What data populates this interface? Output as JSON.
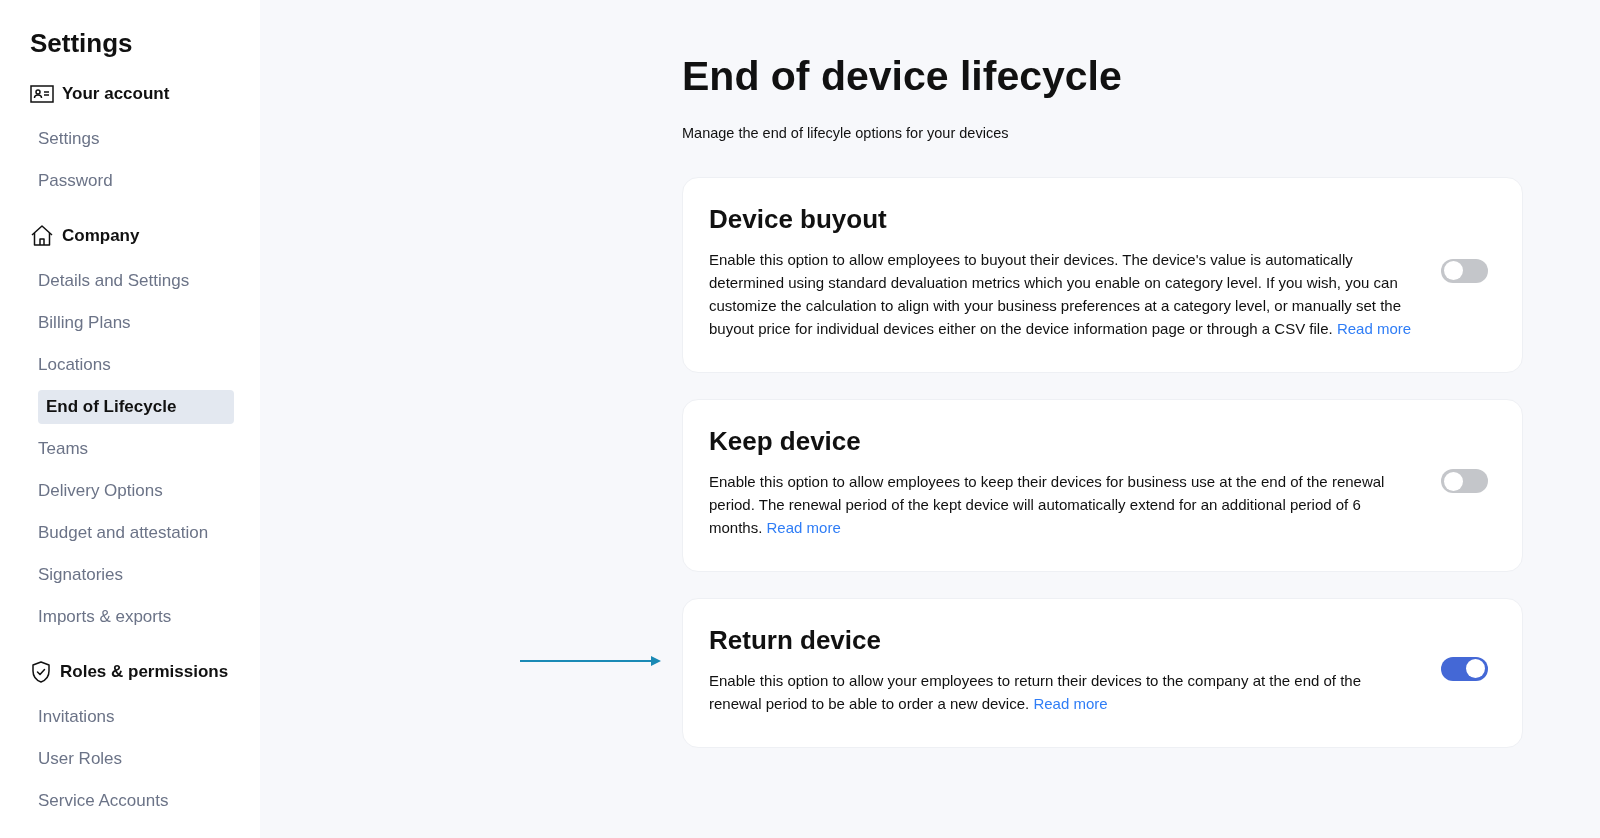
{
  "sidebar": {
    "title": "Settings",
    "groups": [
      {
        "label": "Your account",
        "items": [
          {
            "label": "Settings",
            "selected": false
          },
          {
            "label": "Password",
            "selected": false
          }
        ]
      },
      {
        "label": "Company",
        "items": [
          {
            "label": "Details and Settings",
            "selected": false
          },
          {
            "label": "Billing Plans",
            "selected": false
          },
          {
            "label": "Locations",
            "selected": false
          },
          {
            "label": "End of Lifecycle",
            "selected": true
          },
          {
            "label": "Teams",
            "selected": false
          },
          {
            "label": "Delivery Options",
            "selected": false
          },
          {
            "label": "Budget and attestation",
            "selected": false
          },
          {
            "label": "Signatories",
            "selected": false
          },
          {
            "label": "Imports & exports",
            "selected": false
          }
        ]
      },
      {
        "label": "Roles & permissions",
        "items": [
          {
            "label": "Invitations",
            "selected": false
          },
          {
            "label": "User Roles",
            "selected": false
          },
          {
            "label": "Service Accounts",
            "selected": false
          }
        ]
      }
    ]
  },
  "page": {
    "title": "End of device lifecycle",
    "subtitle": "Manage the end of lifecyle options for your devices"
  },
  "options": [
    {
      "title": "Device buyout",
      "description": "Enable this option to allow employees to buyout their devices. The device's value is automatically determined using standard devaluation metrics which you enable on category level. If you wish, you can customize the calculation to align with your business preferences at a category level, or manually set the buyout price for individual devices either on the device information page or through a CSV file.",
      "link": "Read more",
      "on": false,
      "highlighted": false
    },
    {
      "title": "Keep device",
      "description": "Enable this option to allow employees to keep their devices for business use at the end of the renewal period. The renewal period of the kept device will automatically extend for an additional period of 6 months.",
      "link": "Read more",
      "on": false,
      "highlighted": false
    },
    {
      "title": "Return device",
      "description": "Enable this option to allow your employees to return their devices to the company at the end of the renewal period to be able to order a new device.",
      "link": "Read more",
      "on": true,
      "highlighted": true
    }
  ]
}
